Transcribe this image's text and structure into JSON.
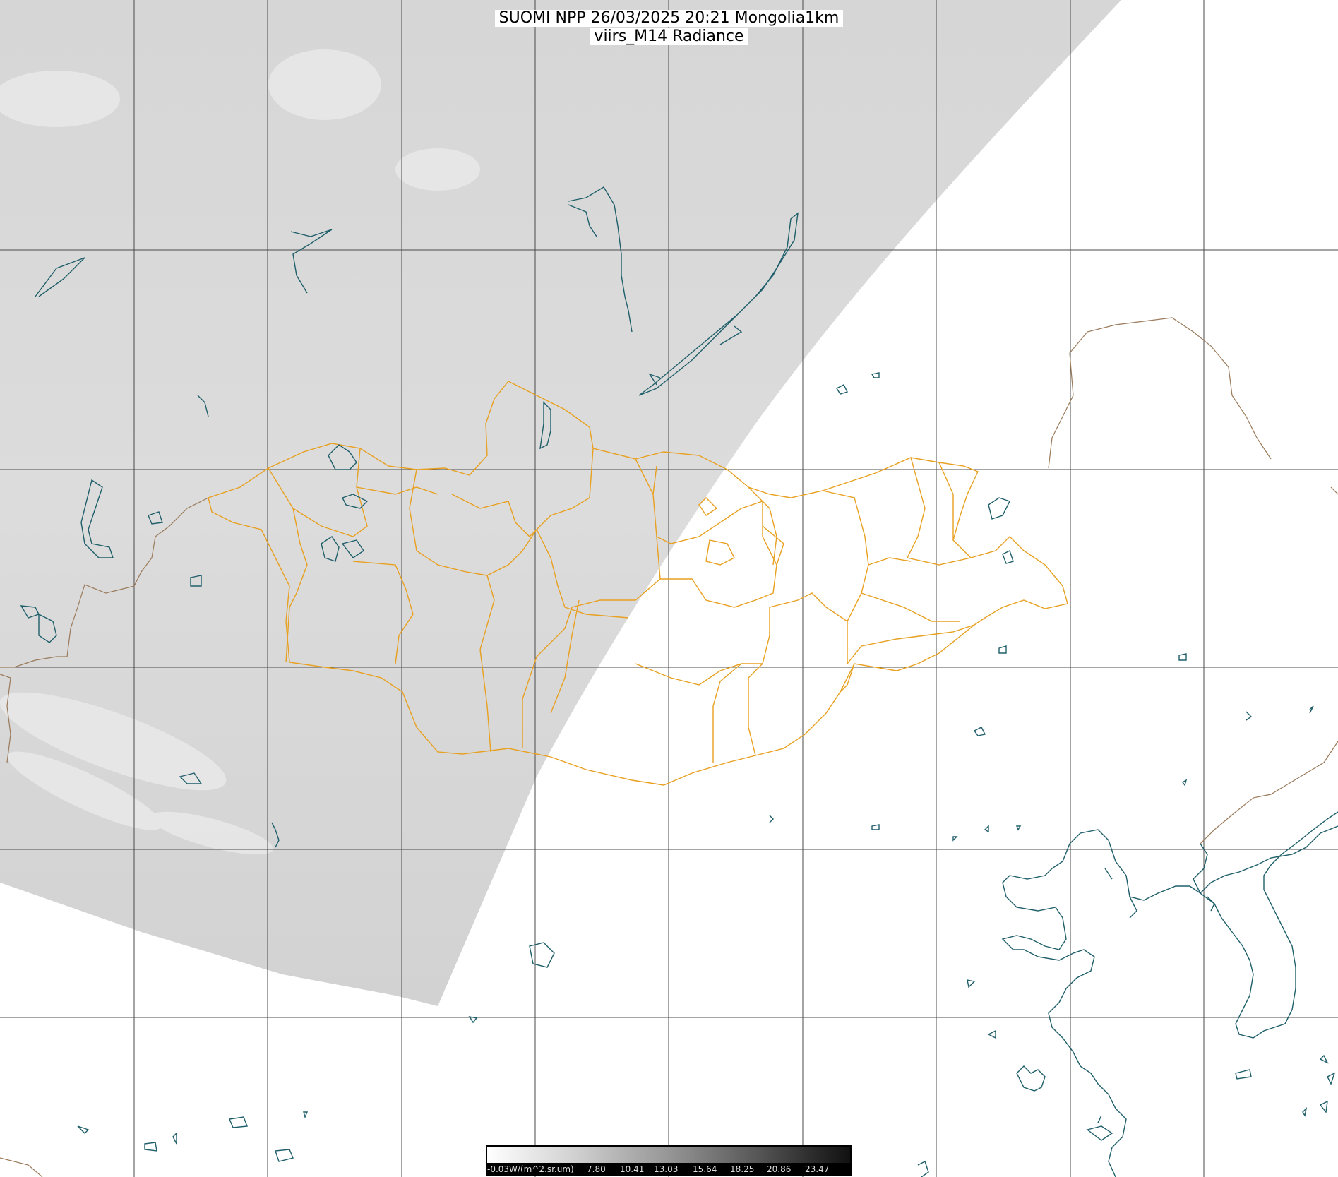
{
  "title": {
    "line1": "SUOMI NPP 26/03/2025 20:21 Mongolia1km",
    "line2": "viirs_M14 Radiance"
  },
  "colorbar": {
    "labels": [
      "-0.03W/(m^2.sr.um)",
      "7.80",
      "10.41",
      "13.03",
      "15.64",
      "18.25",
      "20.86",
      "23.47"
    ]
  },
  "colors": {
    "satellite_swath": "#dcdcdc",
    "grid": "#4a4a4a",
    "coastline": "#1f5f6a",
    "border_orange": "#e8a020",
    "border_brown": "#9a7a5a",
    "background": "#ffffff"
  }
}
